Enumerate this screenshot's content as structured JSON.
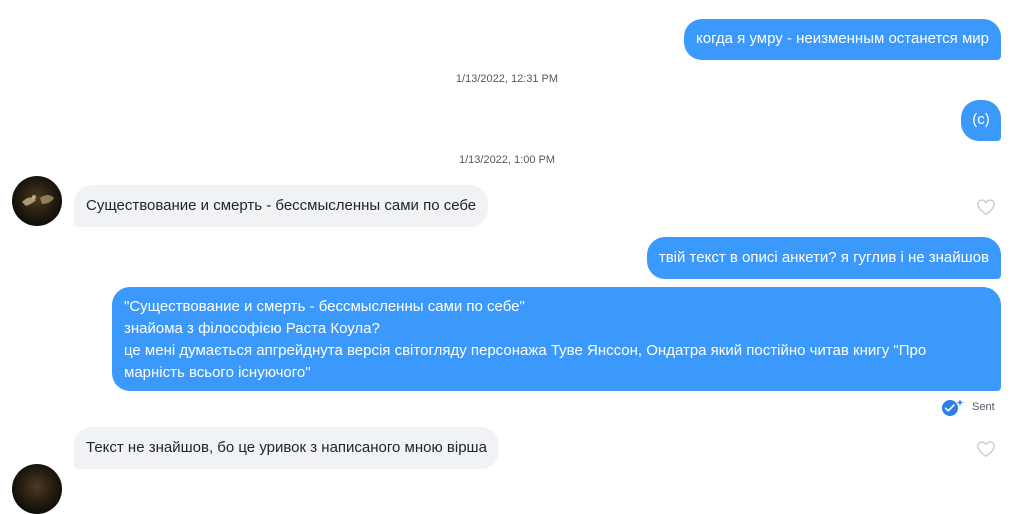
{
  "messages": [
    {
      "id": "m1",
      "direction": "out",
      "text": "когда я умру - неизменным останется мир"
    },
    {
      "id": "ts1",
      "type": "timestamp",
      "text": "1/13/2022, 12:31 PM"
    },
    {
      "id": "m2",
      "direction": "out",
      "text": "(с)"
    },
    {
      "id": "ts2",
      "type": "timestamp",
      "text": "1/13/2022, 1:00 PM"
    },
    {
      "id": "m3",
      "direction": "in",
      "text": "Существование и смерть - бессмысленны сами по себе"
    },
    {
      "id": "m4",
      "direction": "out",
      "text": "твій текст в описі анкети? я гуглив і не знайшов"
    },
    {
      "id": "m5",
      "direction": "out",
      "lines": [
        "\"Существование и смерть - бессмысленны сами по себе\"",
        "знайома з філософією Раста Коула?",
        "це мені думається апгрейднута версія світогляду персонажа Туве Янссон, Ондатра який постійно читав книгу \"Про",
        "марність всього існуючого\""
      ]
    },
    {
      "id": "m6",
      "direction": "in",
      "text": "Текст не знайшов, бо це уривок з написаного мною вірша"
    }
  ],
  "status": {
    "sent_label": "Sent"
  },
  "icons": {
    "like": "heart-outline-icon",
    "sent": "double-check-sparkle-icon"
  },
  "colors": {
    "outgoing_bubble": "#3c99fc",
    "incoming_bubble": "#f0f2f4",
    "heart_outline": "#c8ccd2"
  }
}
